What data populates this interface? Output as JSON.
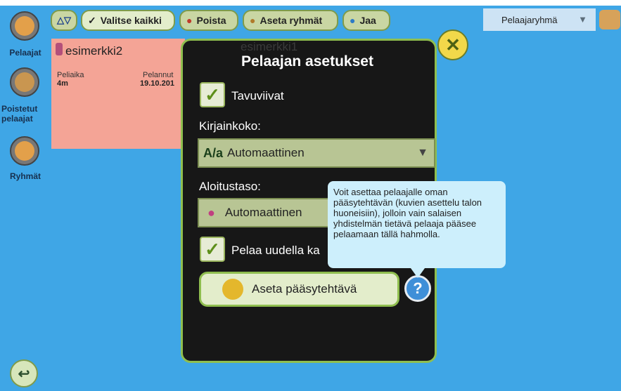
{
  "toolbar": {
    "sort_icon": "sort-arrows-icon",
    "select_all": "Valitse kaikki",
    "delete": "Poista",
    "set_groups": "Aseta ryhmät",
    "share": "Jaa"
  },
  "group_select": {
    "value": "Pelaajaryhmä"
  },
  "sidebar": {
    "items": [
      {
        "label": "Pelaajat"
      },
      {
        "label": "Poistetut pelaajat"
      },
      {
        "label": "Ryhmät"
      }
    ]
  },
  "player_card": {
    "name": "esimerkki2",
    "playtime_label": "Peliaika",
    "playtime_value": "4m",
    "played_label": "Pelannut",
    "played_value": "19.10.201"
  },
  "background_card": {
    "name": "esimerkki1"
  },
  "modal": {
    "title": "Pelaajan asetukset",
    "guidelines_label": "Tavuviivat",
    "font_size_label": "Kirjainkoko:",
    "font_size_value": "Automaattinen",
    "start_level_label": "Aloitustaso:",
    "start_level_value": "Automaattinen",
    "play_new_label": "Pelaa uudella ka",
    "set_password_button": "Aseta pääsytehtävä",
    "help_glyph": "?"
  },
  "tooltip": {
    "text": "Voit asettaa pelaajalle oman pääsytehtävän (kuvien asettelu talon huoneisiin), jolloin vain salaisen yhdistelmän tietävä pelaaja pääsee pelaamaan tällä hahmolla."
  },
  "colors": {
    "background": "#3fa6e6",
    "modal_bg": "#171717",
    "accent_green": "#8fbe4f",
    "card_salmon": "#f4a496"
  }
}
